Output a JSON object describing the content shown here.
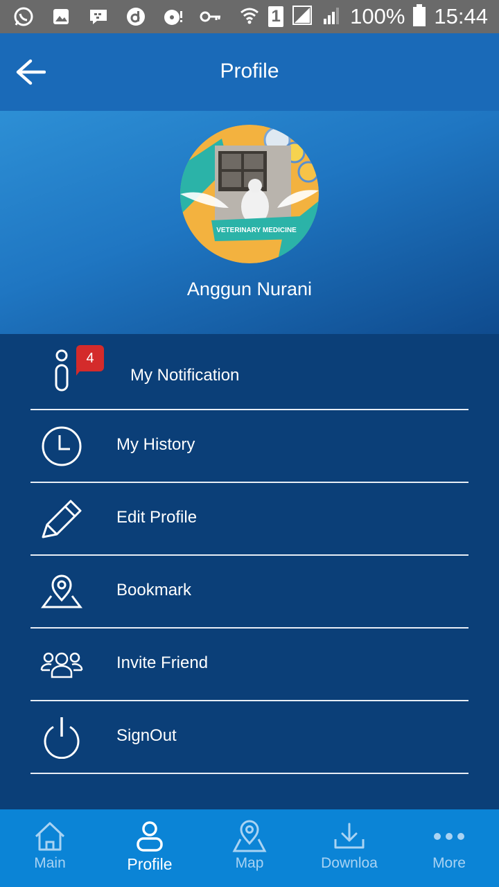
{
  "status_bar": {
    "battery": "100%",
    "time": "15:44",
    "sim": "1"
  },
  "app_bar": {
    "title": "Profile"
  },
  "profile": {
    "name": "Anggun Nurani",
    "avatar_banner": "VETERINARY MEDICINE"
  },
  "menu": {
    "items": [
      {
        "label": "My Notification",
        "icon": "info-icon",
        "badge": "4"
      },
      {
        "label": "My History",
        "icon": "clock-icon"
      },
      {
        "label": "Edit Profile",
        "icon": "pencil-icon"
      },
      {
        "label": "Bookmark",
        "icon": "map-pin-icon"
      },
      {
        "label": "Invite Friend",
        "icon": "group-icon"
      },
      {
        "label": "SignOut",
        "icon": "power-icon"
      }
    ]
  },
  "bottom_nav": {
    "items": [
      {
        "label": "Main",
        "icon": "home-icon"
      },
      {
        "label": "Profile",
        "icon": "user-icon",
        "active": true
      },
      {
        "label": "Map",
        "icon": "map-pin-icon"
      },
      {
        "label": "Downloa",
        "icon": "download-icon"
      },
      {
        "label": "More",
        "icon": "more-icon"
      }
    ]
  },
  "colors": {
    "status_bar": "#6a6a6a",
    "app_bar": "#1a6ab8",
    "menu_bg": "#0b3f78",
    "bottom_nav": "#0b84d6",
    "badge": "#d42b2b"
  }
}
